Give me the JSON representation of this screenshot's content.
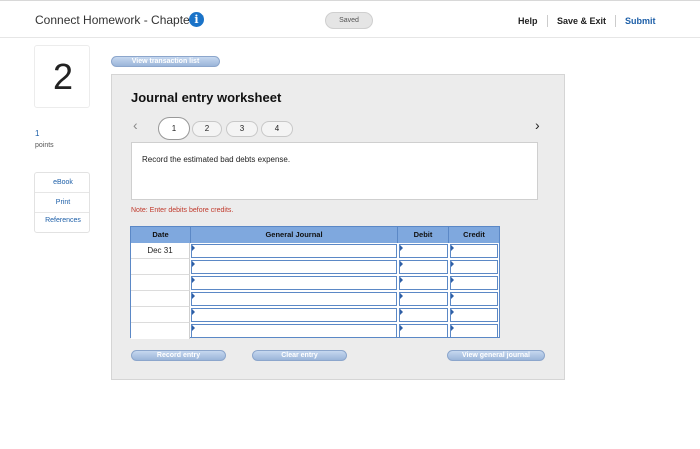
{
  "header": {
    "title": "Connect Homework - Chapter 7",
    "saved": "Saved",
    "help": "Help",
    "save_exit": "Save & Exit",
    "submit": "Submit"
  },
  "question": {
    "number": "2",
    "points_value": "1",
    "points_label": "points"
  },
  "side_links": {
    "ebook": "eBook",
    "print": "Print",
    "references": "References"
  },
  "worksheet": {
    "view_transaction_list": "View transaction list",
    "title": "Journal entry worksheet",
    "steps": [
      "1",
      "2",
      "3",
      "4"
    ],
    "active_step": 1,
    "description": "Record the estimated bad debts expense.",
    "note": "Note: Enter debits before credits.",
    "columns": {
      "date": "Date",
      "general_journal": "General Journal",
      "debit": "Debit",
      "credit": "Credit"
    },
    "rows": [
      {
        "date": "Dec 31",
        "account": "",
        "debit": "",
        "credit": ""
      },
      {
        "date": "",
        "account": "",
        "debit": "",
        "credit": ""
      },
      {
        "date": "",
        "account": "",
        "debit": "",
        "credit": ""
      },
      {
        "date": "",
        "account": "",
        "debit": "",
        "credit": ""
      },
      {
        "date": "",
        "account": "",
        "debit": "",
        "credit": ""
      },
      {
        "date": "",
        "account": "",
        "debit": "",
        "credit": ""
      }
    ],
    "record_entry": "Record entry",
    "clear_entry": "Clear entry",
    "view_general_journal": "View general journal"
  },
  "colors": {
    "accent": "#1d5fa8",
    "header_blue": "#7fa8de",
    "button_blue": "#9bb5d9",
    "note_red": "#c0392b"
  },
  "icons": {
    "info": "info-icon",
    "prev": "chevron-left-icon",
    "next": "chevron-right-icon"
  }
}
